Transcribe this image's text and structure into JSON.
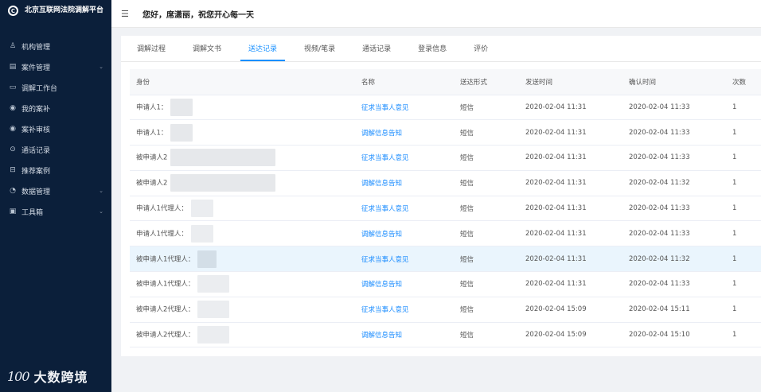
{
  "sidebar": {
    "brand_icon": "logo-c-icon",
    "brand_title": "北京互联网法院调解平台",
    "items": [
      {
        "icon": "org-icon",
        "label": "机构管理",
        "expandable": false
      },
      {
        "icon": "file-icon",
        "label": "案件管理",
        "expandable": true
      },
      {
        "icon": "monitor-icon",
        "label": "调解工作台",
        "expandable": false
      },
      {
        "icon": "circle-icon",
        "label": "我的案补",
        "expandable": false
      },
      {
        "icon": "circle-icon",
        "label": "案补审核",
        "expandable": false
      },
      {
        "icon": "phone-icon",
        "label": "通话记录",
        "expandable": false
      },
      {
        "icon": "lock-icon",
        "label": "推荐案例",
        "expandable": false
      },
      {
        "icon": "chart-icon",
        "label": "数据管理",
        "expandable": true
      },
      {
        "icon": "toolbox-icon",
        "label": "工具箱",
        "expandable": true
      }
    ],
    "footer_logo": "100",
    "footer_text": "大数跨境"
  },
  "header": {
    "greeting": "您好，席潇丽，祝您开心每一天"
  },
  "tabs": [
    {
      "label": "调解过程",
      "active": false
    },
    {
      "label": "调解文书",
      "active": false
    },
    {
      "label": "送达记录",
      "active": true
    },
    {
      "label": "视频/笔录",
      "active": false
    },
    {
      "label": "通话记录",
      "active": false
    },
    {
      "label": "登录信息",
      "active": false
    },
    {
      "label": "评价",
      "active": false
    }
  ],
  "table": {
    "columns": [
      "身份",
      "名称",
      "送达形式",
      "发送时间",
      "确认时间",
      "次数"
    ],
    "rows": [
      {
        "identity": "申请人1：",
        "name": "征求当事人意见",
        "form": "短信",
        "sent": "2020-02-04 11:31",
        "confirmed": "2020-02-04 11:33",
        "count": "1"
      },
      {
        "identity": "申请人1：",
        "name": "调解信息告知",
        "form": "短信",
        "sent": "2020-02-04 11:31",
        "confirmed": "2020-02-04 11:33",
        "count": "1"
      },
      {
        "identity": "被申请人2",
        "name": "征求当事人意见",
        "form": "短信",
        "sent": "2020-02-04 11:31",
        "confirmed": "2020-02-04 11:33",
        "count": "1"
      },
      {
        "identity": "被申请人2",
        "name": "调解信息告知",
        "form": "短信",
        "sent": "2020-02-04 11:31",
        "confirmed": "2020-02-04 11:32",
        "count": "1"
      },
      {
        "identity": "申请人1代理人：",
        "name": "征求当事人意见",
        "form": "短信",
        "sent": "2020-02-04 11:31",
        "confirmed": "2020-02-04 11:33",
        "count": "1"
      },
      {
        "identity": "申请人1代理人：",
        "name": "调解信息告知",
        "form": "短信",
        "sent": "2020-02-04 11:31",
        "confirmed": "2020-02-04 11:33",
        "count": "1"
      },
      {
        "identity": "被申请人1代理人：",
        "name": "征求当事人意见",
        "form": "短信",
        "sent": "2020-02-04 11:31",
        "confirmed": "2020-02-04 11:32",
        "count": "1"
      },
      {
        "identity": "被申请人1代理人：",
        "name": "调解信息告知",
        "form": "短信",
        "sent": "2020-02-04 11:31",
        "confirmed": "2020-02-04 11:33",
        "count": "1"
      },
      {
        "identity": "被申请人2代理人：",
        "name": "征求当事人意见",
        "form": "短信",
        "sent": "2020-02-04 15:09",
        "confirmed": "2020-02-04 15:11",
        "count": "1"
      },
      {
        "identity": "被申请人2代理人：",
        "name": "调解信息告知",
        "form": "短信",
        "sent": "2020-02-04 15:09",
        "confirmed": "2020-02-04 15:10",
        "count": "1"
      }
    ]
  },
  "colors": {
    "sidebar_bg": "#0b1f3a",
    "accent": "#1890ff",
    "highlight_row": "#eaf5fd"
  }
}
